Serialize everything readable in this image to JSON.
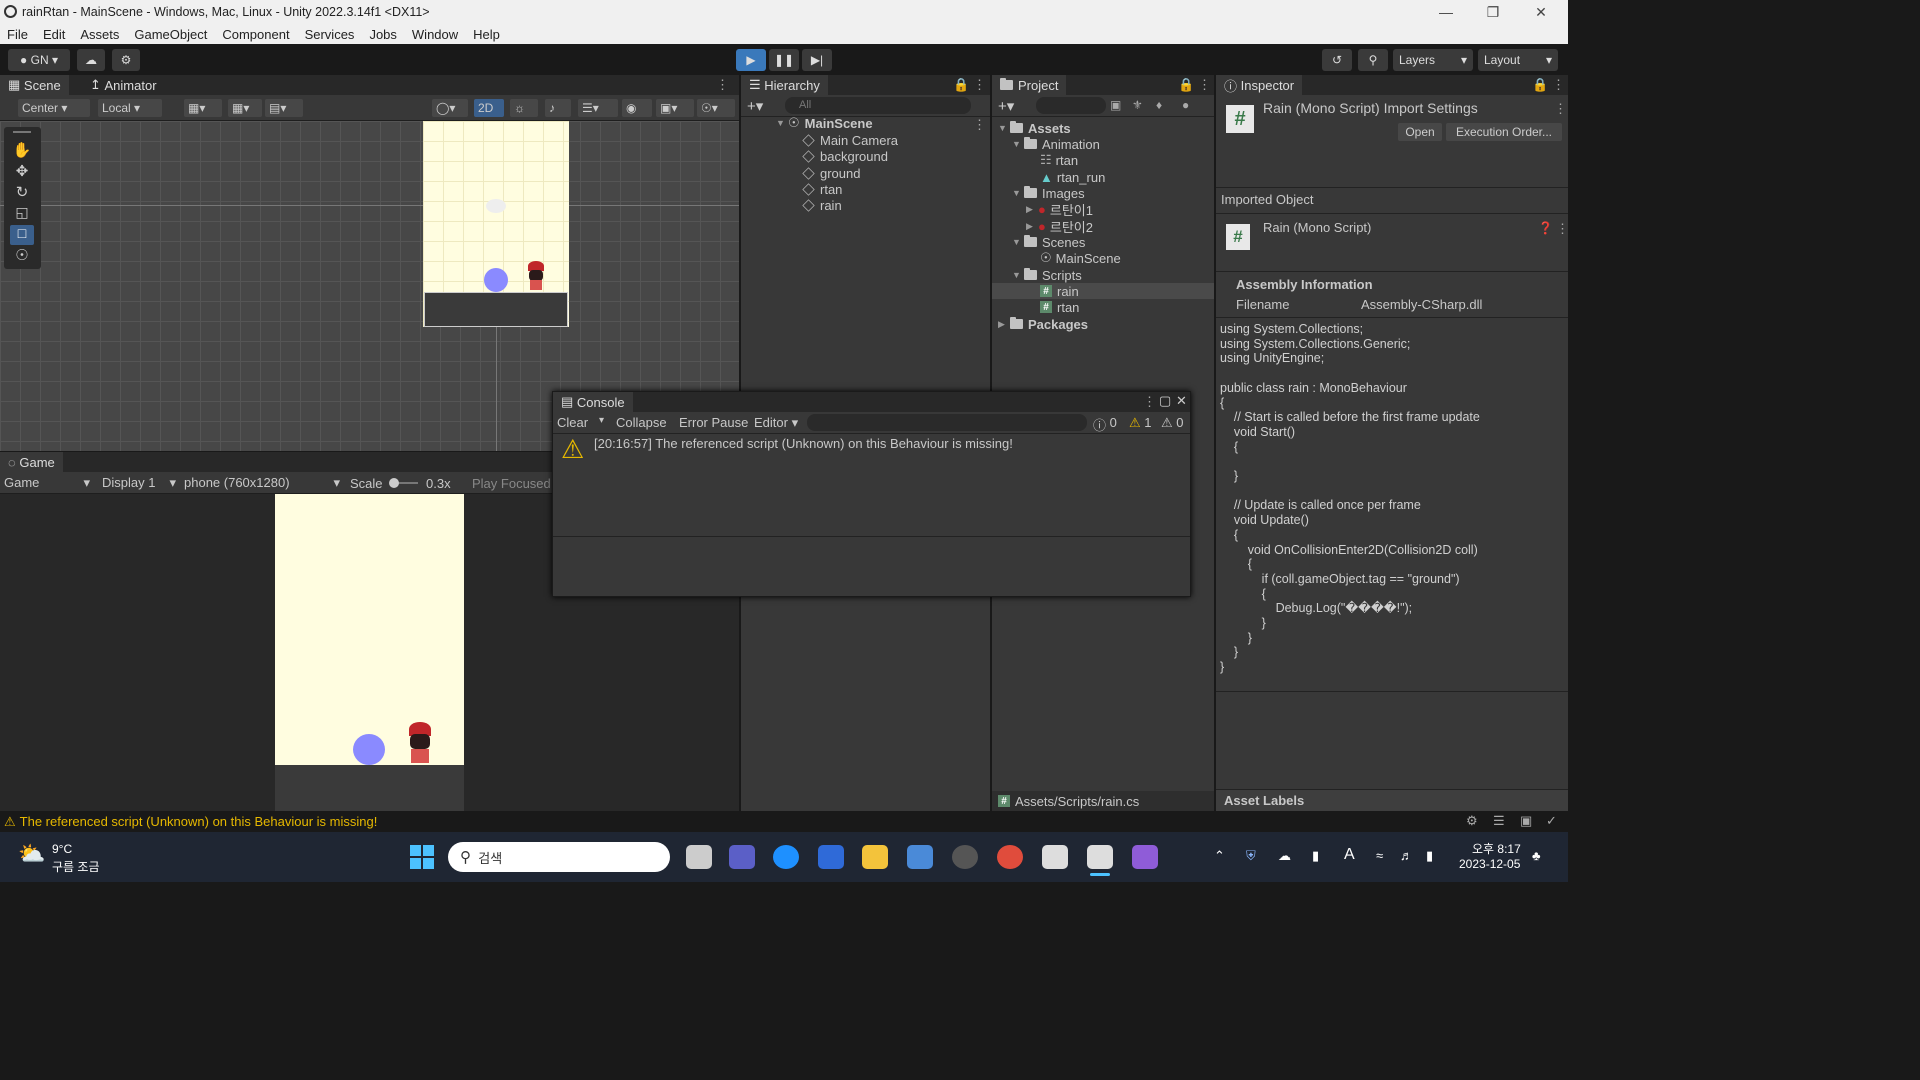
{
  "window": {
    "title": "rainRtan - MainScene - Windows, Mac, Linux - Unity 2022.3.14f1 <DX11>"
  },
  "menu": [
    "File",
    "Edit",
    "Assets",
    "GameObject",
    "Component",
    "Services",
    "Jobs",
    "Window",
    "Help"
  ],
  "toolbar": {
    "account": "GN",
    "layers": "Layers",
    "layout": "Layout"
  },
  "scene": {
    "tab": "Scene",
    "tab2": "Animator",
    "pivot": "Center",
    "space": "Local",
    "mode2d": "2D"
  },
  "game": {
    "tab": "Game",
    "view": "Game",
    "display": "Display 1",
    "resolution": "phone (760x1280)",
    "scale_label": "Scale",
    "scale_value": "0.3x",
    "play": "Play Focused"
  },
  "hierarchy": {
    "tab": "Hierarchy",
    "search": "All",
    "scene": "MainScene",
    "items": [
      "Main Camera",
      "background",
      "ground",
      "rtan",
      "rain"
    ]
  },
  "project": {
    "tab": "Project",
    "assets": "Assets",
    "animation": "Animation",
    "anim_items": [
      "rtan",
      "rtan_run"
    ],
    "images": "Images",
    "image_items": [
      "르탄이1",
      "르탄이2"
    ],
    "scenes": "Scenes",
    "scene_items": [
      "MainScene"
    ],
    "scripts": "Scripts",
    "script_items": [
      "rain",
      "rtan"
    ],
    "packages": "Packages",
    "path": "Assets/Scripts/rain.cs"
  },
  "inspector": {
    "tab": "Inspector",
    "title": "Rain (Mono Script) Import Settings",
    "open": "Open",
    "exec": "Execution Order...",
    "imported": "Imported Object",
    "script_name": "Rain (Mono Script)",
    "assembly_title": "Assembly Information",
    "filename_label": "Filename",
    "filename_value": "Assembly-CSharp.dll",
    "asset_labels": "Asset Labels",
    "code": "using System.Collections;\nusing System.Collections.Generic;\nusing UnityEngine;\n\npublic class rain : MonoBehaviour\n{\n    // Start is called before the first frame update\n    void Start()\n    {\n\n    }\n\n    // Update is called once per frame\n    void Update()\n    {\n        void OnCollisionEnter2D(Collision2D coll)\n        {\n            if (coll.gameObject.tag == \"ground\")\n            {\n                Debug.Log(\"����!\");\n            }\n        }\n    }\n}"
  },
  "console": {
    "tab": "Console",
    "clear": "Clear",
    "collapse": "Collapse",
    "error_pause": "Error Pause",
    "editor": "Editor",
    "count_info": "0",
    "count_warn": "1",
    "count_err": "0",
    "message": "[20:16:57] The referenced script (Unknown) on this Behaviour is missing!"
  },
  "statusbar": {
    "message": "The referenced script (Unknown) on this Behaviour is missing!"
  },
  "taskbar": {
    "temp": "9°C",
    "weather": "구름 조금",
    "search": "검색",
    "time": "오후 8:17",
    "date": "2023-12-05"
  },
  "colors": {
    "accent": "#3a79bb",
    "warn": "#e6b800",
    "sky": "#fffde0",
    "ball": "#8a8aff"
  }
}
